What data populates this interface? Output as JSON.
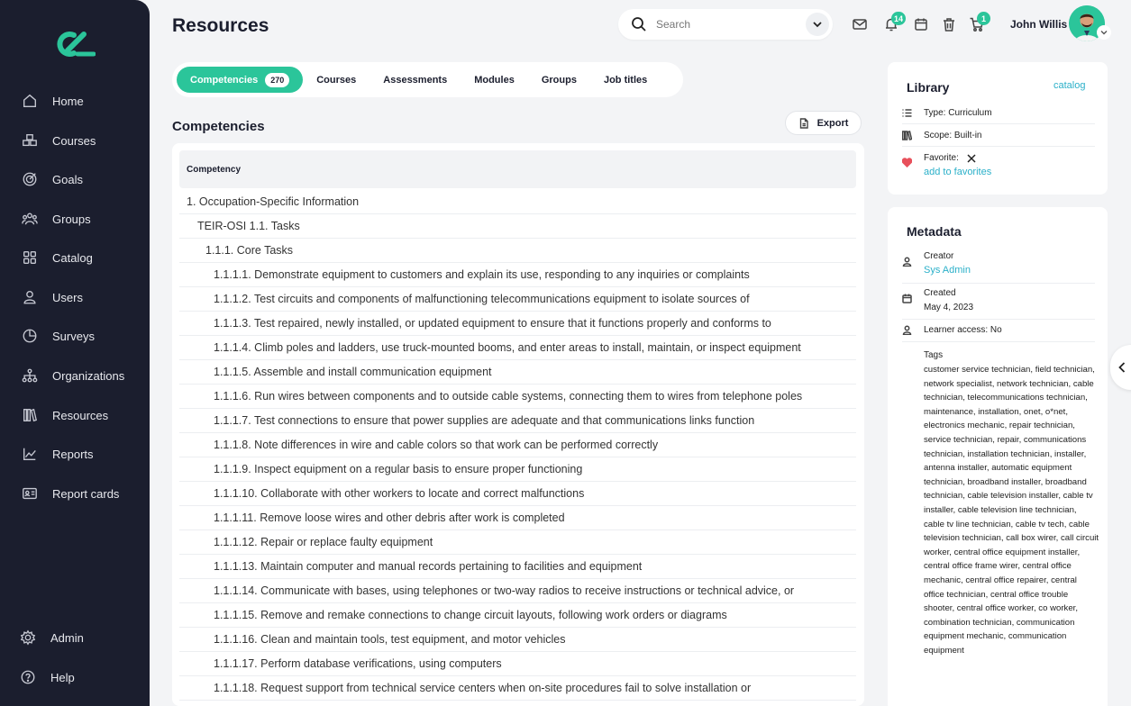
{
  "sidebar": {
    "items": [
      {
        "label": "Home",
        "icon": "home-icon"
      },
      {
        "label": "Courses",
        "icon": "courses-icon"
      },
      {
        "label": "Goals",
        "icon": "target-icon"
      },
      {
        "label": "Groups",
        "icon": "groups-icon"
      },
      {
        "label": "Catalog",
        "icon": "grid-icon"
      },
      {
        "label": "Users",
        "icon": "user-icon"
      },
      {
        "label": "Surveys",
        "icon": "pie-chart-icon"
      },
      {
        "label": "Organizations",
        "icon": "org-chart-icon"
      },
      {
        "label": "Resources",
        "icon": "library-icon"
      },
      {
        "label": "Reports",
        "icon": "area-chart-icon"
      },
      {
        "label": "Report cards",
        "icon": "id-card-icon"
      }
    ],
    "bottom": [
      {
        "label": "Admin",
        "icon": "gear-icon"
      },
      {
        "label": "Help",
        "icon": "help-icon"
      }
    ]
  },
  "header": {
    "title": "Resources",
    "search_placeholder": "Search",
    "notifications_count": "14",
    "cart_count": "1",
    "user_name": "John Willis"
  },
  "tabs": [
    {
      "label": "Competencies",
      "count": "270",
      "active": true
    },
    {
      "label": "Courses"
    },
    {
      "label": "Assessments"
    },
    {
      "label": "Modules"
    },
    {
      "label": "Groups"
    },
    {
      "label": "Job titles"
    }
  ],
  "section": {
    "title": "Competencies",
    "export_label": "Export"
  },
  "table": {
    "header": "Competency",
    "rows": [
      {
        "text": "1. Occupation-Specific Information",
        "level": 0
      },
      {
        "text": "TEIR-OSI 1.1. Tasks",
        "level": 1
      },
      {
        "text": "1.1.1. Core Tasks",
        "level": 2
      },
      {
        "text": "1.1.1.1. Demonstrate equipment to customers and explain its use, responding to any inquiries or complaints",
        "level": 3
      },
      {
        "text": "1.1.1.2. Test circuits and components of malfunctioning telecommunications equipment to isolate sources of",
        "level": 3
      },
      {
        "text": "1.1.1.3. Test repaired, newly installed, or updated equipment to ensure that it functions properly and conforms to",
        "level": 3
      },
      {
        "text": "1.1.1.4. Climb poles and ladders, use truck-mounted booms, and enter areas to install, maintain, or inspect equipment",
        "level": 3
      },
      {
        "text": "1.1.1.5. Assemble and install communication equipment",
        "level": 3
      },
      {
        "text": "1.1.1.6. Run wires between components and to outside cable systems, connecting them to wires from telephone poles",
        "level": 3
      },
      {
        "text": "1.1.1.7. Test connections to ensure that power supplies are adequate and that communications links function",
        "level": 3
      },
      {
        "text": "1.1.1.8. Note differences in wire and cable colors so that work can be performed correctly",
        "level": 3
      },
      {
        "text": "1.1.1.9. Inspect equipment on a regular basis to ensure proper functioning",
        "level": 3
      },
      {
        "text": "1.1.1.10. Collaborate with other workers to locate and correct malfunctions",
        "level": 3
      },
      {
        "text": "1.1.1.11. Remove loose wires and other debris after work is completed",
        "level": 3
      },
      {
        "text": "1.1.1.12. Repair or replace faulty equipment",
        "level": 3
      },
      {
        "text": "1.1.1.13. Maintain computer and manual records pertaining to facilities and equipment",
        "level": 3
      },
      {
        "text": "1.1.1.14. Communicate with bases, using telephones or two-way radios to receive instructions or technical advice, or",
        "level": 3
      },
      {
        "text": "1.1.1.15. Remove and remake connections to change circuit layouts, following work orders or diagrams",
        "level": 3
      },
      {
        "text": "1.1.1.16. Clean and maintain tools, test equipment, and motor vehicles",
        "level": 3
      },
      {
        "text": "1.1.1.17. Perform database verifications, using computers",
        "level": 3
      },
      {
        "text": "1.1.1.18. Request support from technical service centers when on-site procedures fail to solve installation or",
        "level": 3
      }
    ]
  },
  "library": {
    "title": "Library",
    "catalog_link": "catalog",
    "type": "Type: Curriculum",
    "scope": "Scope: Built-in",
    "favorite_label": "Favorite:",
    "add_favorites": "add to favorites"
  },
  "metadata": {
    "title": "Metadata",
    "creator_label": "Creator",
    "creator_value": "Sys Admin",
    "created_label": "Created",
    "created_value": "May 4, 2023",
    "learner_access": "Learner access: No",
    "tags_label": "Tags",
    "tags": "customer service technician, field technician, network specialist, network technician, cable technician, telecommunications technician, maintenance, installation, onet, o*net, electronics mechanic, repair technician, service technician, repair, communications technician, installation technician, installer, antenna installer, automatic equipment technician, broadband installer, broadband technician, cable television installer, cable tv installer, cable television line technician, cable tv line technician, cable tv tech, cable television technician, call box wirer, call circuit worker, central office equipment installer, central office frame wirer, central office mechanic, central office repairer, central office technician, central office trouble shooter, central office worker, co worker, combination technician, communication equipment mechanic, communication equipment"
  },
  "colors": {
    "accent": "#2bc59a",
    "sidebar": "#1b1e2e",
    "link": "#2bb0c9",
    "heart": "#e8505b"
  }
}
